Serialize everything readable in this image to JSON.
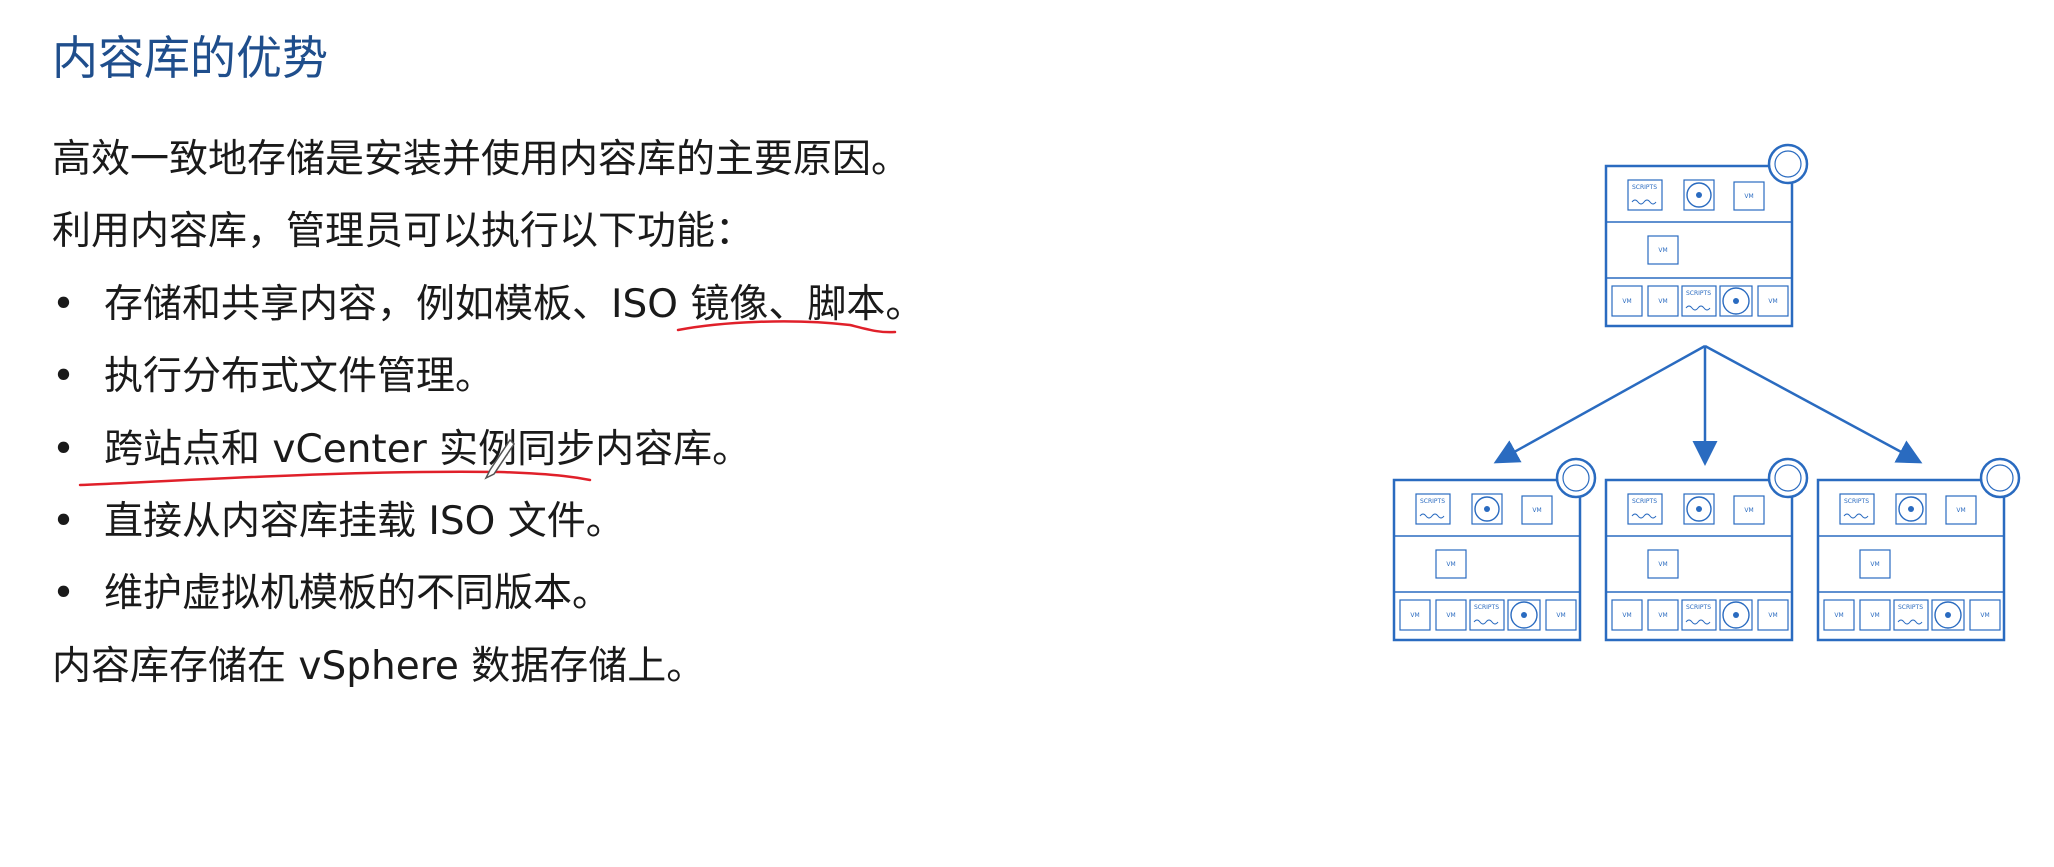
{
  "slide": {
    "title": "内容库的优势",
    "intro1": "高效一致地存储是安装并使用内容库的主要原因。",
    "intro2": "利用内容库，管理员可以执行以下功能：",
    "bullets": [
      {
        "dot": "•",
        "text": "存储和共享内容，例如模板、ISO 镜像、脚本。"
      },
      {
        "dot": "•",
        "text": "执行分布式文件管理。"
      },
      {
        "dot": "•",
        "text": "跨站点和 vCenter 实例同步内容库。"
      },
      {
        "dot": "•",
        "text": "直接从内容库挂载 ISO 文件。"
      },
      {
        "dot": "•",
        "text": "维护虚拟机模板的不同版本。"
      }
    ],
    "footer": "内容库存储在 vSphere 数据存储上。"
  },
  "diagram": {
    "vm_label": "VM",
    "script_label": "SCRIPTS",
    "accent_color": "#2a6bc0"
  },
  "colors": {
    "title": "#1f4e8c",
    "annotation": "#e0202a"
  }
}
